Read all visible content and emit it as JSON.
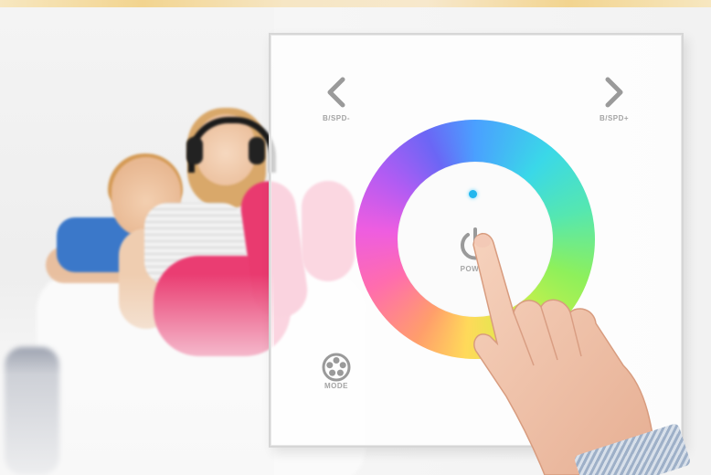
{
  "photo": {
    "subject": "two women relaxing on a sofa with a touch RGB LED controller panel",
    "colors": {
      "background": "#f3f3f3",
      "pants": "#ea3d72",
      "shirt_blue": "#3b78c9",
      "indicator": "#22b7ee"
    }
  },
  "panel": {
    "speed_down": {
      "icon": "chevron-left-icon",
      "label": "B/SPD-"
    },
    "speed_up": {
      "icon": "chevron-right-icon",
      "label": "B/SPD+"
    },
    "power": {
      "icon": "power-icon",
      "label": "POWER"
    },
    "mode": {
      "icon": "film-reel-icon",
      "label": "MODE"
    },
    "color_wheel": {
      "description_icon": "color-ring"
    }
  }
}
